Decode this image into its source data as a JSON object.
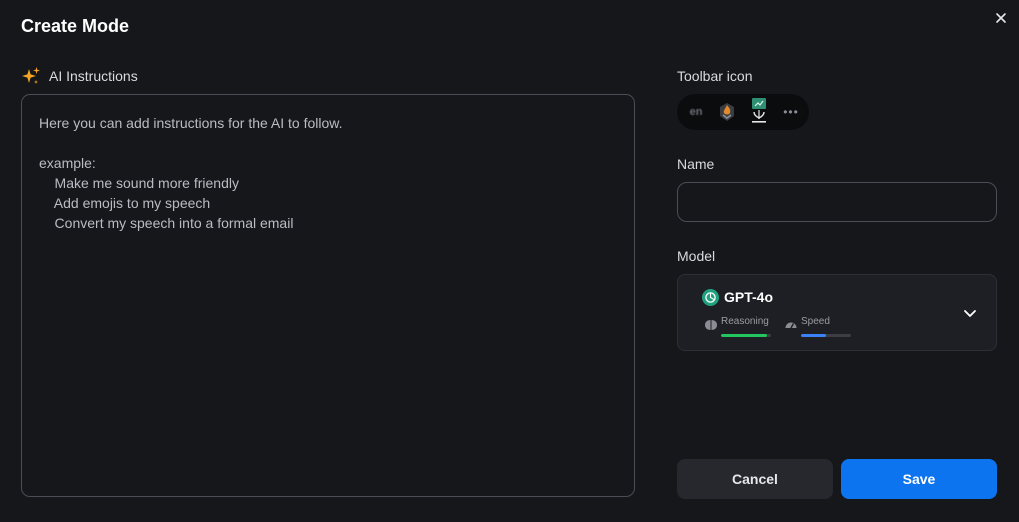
{
  "dialog": {
    "title": "Create Mode",
    "close_icon": "close-icon"
  },
  "instructions": {
    "label": "AI Instructions",
    "icon": "sparkles-icon",
    "placeholder": "Here you can add instructions for the AI to follow.\n\nexample:\n    Make me sound more friendly\n    Add emojis to my speech\n    Convert my speech into a formal email"
  },
  "toolbar_icon": {
    "label": "Toolbar icon",
    "options": [
      {
        "text": "en",
        "icon": "language-en-icon"
      },
      {
        "text": "",
        "icon": "flame-badge-icon"
      },
      {
        "text": "",
        "icon": "shield-chart-icon"
      },
      {
        "text": "•••",
        "icon": "more-icon"
      }
    ]
  },
  "name": {
    "label": "Name",
    "value": ""
  },
  "model": {
    "label": "Model",
    "selected": "GPT-4o",
    "logo": "openai-logo-icon",
    "metrics": [
      {
        "label": "Reasoning",
        "icon": "brain-icon",
        "level": 0.92,
        "color": "#22c55e"
      },
      {
        "label": "Speed",
        "icon": "gauge-icon",
        "level": 0.5,
        "color": "#3b82f6"
      }
    ]
  },
  "actions": {
    "cancel_label": "Cancel",
    "save_label": "Save",
    "save_color": "#0d74f0"
  }
}
